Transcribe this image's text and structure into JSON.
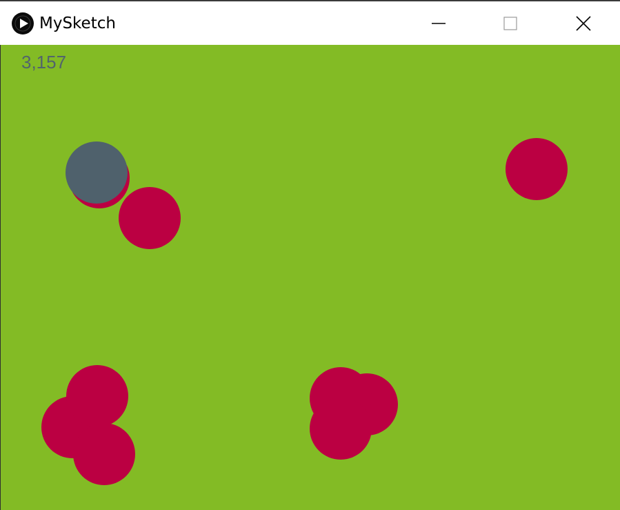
{
  "window": {
    "title": "MySketch",
    "icon": "processing-play-icon",
    "controls": {
      "minimize_icon": "minimize-icon",
      "maximize_icon": "maximize-icon",
      "close_icon": "close-icon"
    }
  },
  "sketch": {
    "score_text": "3,157",
    "colors": {
      "background": "#83bb25",
      "enemy": "#bb0042",
      "player": "#4f616c",
      "score": "#51646c"
    }
  }
}
